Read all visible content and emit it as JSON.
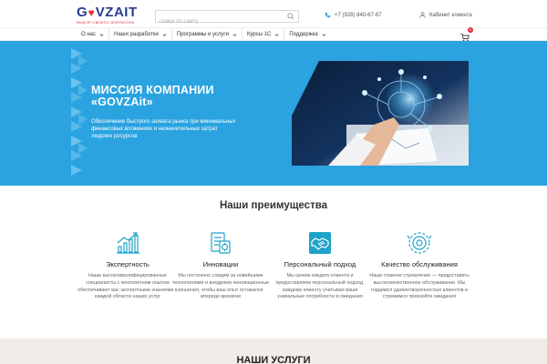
{
  "header": {
    "logo_text_left": "G",
    "logo_text_right": "VZAIT",
    "logo_heart": "♥",
    "logo_tagline": "ВЫБОР СВОЕГО ОПЕРАТОРА",
    "search_placeholder": "Поиск по сайту",
    "phone": "+7 (928) 840-67-67",
    "cabinet": "Кабинет клиента"
  },
  "nav": {
    "items": [
      {
        "label": "О нас"
      },
      {
        "label": "Наши разработки"
      },
      {
        "label": "Программы и услуги"
      },
      {
        "label": "Курсы 1С"
      },
      {
        "label": "Поддержка"
      }
    ],
    "cart_count": "0"
  },
  "hero": {
    "title_line1": "МИССИЯ КОМПАНИИ",
    "title_line2": "«GOVZAit»",
    "subtitle": "Обеспечение быстрого захвата рынка при минимальных финансовых вложениях и незначительных затрат людских ресурсов"
  },
  "advantages": {
    "title": "Наши преимущества",
    "items": [
      {
        "name": "Экспертность",
        "icon": "chart-growth-icon",
        "text": "Наши высококвалифицированные специалисты с многолетним опытом обеспечивают вас экспертными знаниями в каждой области наших услуг"
      },
      {
        "name": "Инновации",
        "icon": "innovation-docs-icon",
        "text": "Мы постоянно следим за новейшими технологиями и внедряем инновационные решения, чтобы ваш опыт оставался впереди времени"
      },
      {
        "name": "Персональный подход",
        "icon": "handshake-icon",
        "text": "Мы ценим каждого клиента и предоставляем персональный подход, каждому клиенту учитывая ваши уникальные потребности и ожидания"
      },
      {
        "name": "Качество обслуживания",
        "icon": "quality-gear-icon",
        "text": "Наше главное стремление — предоставить высококачественное обслуживание. Мы гордимся удовлетворенностью клиентов и стремимся превзойти ожидания"
      }
    ]
  },
  "services": {
    "title": "НАШИ УСЛУГИ"
  },
  "colors": {
    "accent": "#2aa3e0",
    "brand_blue": "#2a3b8f",
    "brand_red": "#e52d3b",
    "icon_teal": "#1fa3c9"
  }
}
